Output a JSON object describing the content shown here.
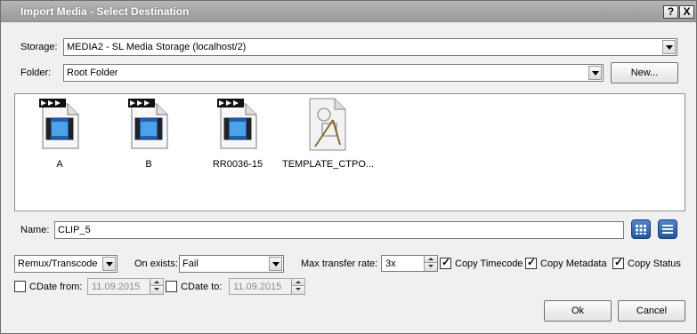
{
  "window": {
    "title": "Import Media - Select Destination",
    "help_label": "?",
    "close_label": "X"
  },
  "storage": {
    "label": "Storage:",
    "value": "MEDIA2 - SL Media Storage (localhost/2)"
  },
  "folder": {
    "label": "Folder:",
    "value": "Root Folder",
    "new_button": "New..."
  },
  "files": [
    {
      "name": "A",
      "icon": "video-file-icon"
    },
    {
      "name": "B",
      "icon": "video-file-icon"
    },
    {
      "name": "RR0036-15",
      "icon": "video-file-icon"
    },
    {
      "name": "TEMPLATE_CTPO...",
      "icon": "template-file-icon"
    }
  ],
  "name_field": {
    "label": "Name:",
    "value": "CLIP_5"
  },
  "view_buttons": [
    "grid-view-icon",
    "list-view-icon"
  ],
  "options": {
    "mode": "Remux/Transcode",
    "on_exists_label": "On exists:",
    "on_exists_value": "Fail",
    "max_rate_label": "Max transfer rate:",
    "max_rate_value": "3x",
    "copy_timecode_label": "Copy Timecode",
    "copy_timecode_checked": true,
    "copy_metadata_label": "Copy Metadata",
    "copy_metadata_checked": true,
    "copy_status_label": "Copy Status",
    "copy_status_checked": true
  },
  "dates": {
    "cdate_from_label": "CDate from:",
    "cdate_from_value": "11.09.2015",
    "cdate_from_checked": false,
    "cdate_to_label": "CDate to:",
    "cdate_to_value": "11.09.2015",
    "cdate_to_checked": false
  },
  "buttons": {
    "ok": "Ok",
    "cancel": "Cancel"
  }
}
